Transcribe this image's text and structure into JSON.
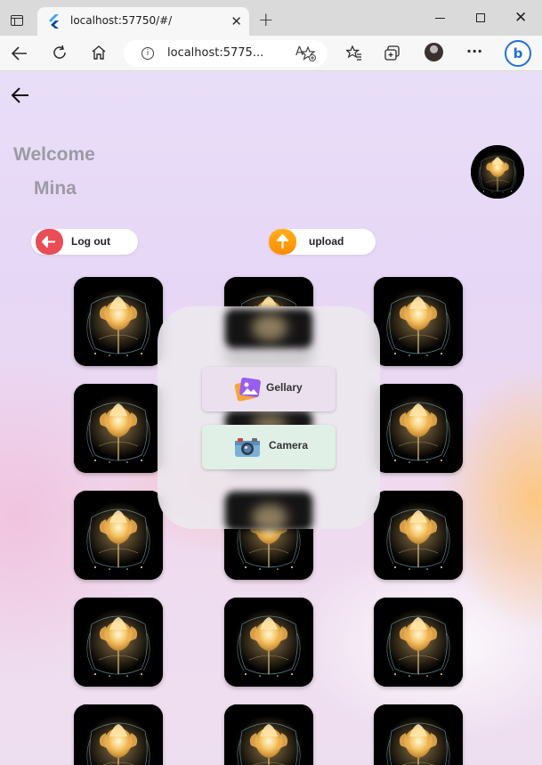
{
  "browser": {
    "tab_title": "localhost:57750/#/",
    "address": "localhost:5775...",
    "tab_close_glyph": "✕",
    "new_tab_glyph": "+",
    "window_close_glyph": "✕",
    "more_glyph": "···",
    "bing_letter": "b"
  },
  "app": {
    "welcome": "Welcome",
    "username": "Mina",
    "logout_label": "Log out",
    "upload_label": "upload",
    "dialog": {
      "gallery_label": "Gellary",
      "camera_label": "Camera"
    },
    "colors": {
      "logout_icon_bg": "#ea4d55",
      "upload_icon_bg": "#ff9a00",
      "gallery_button_bg": "#ebe1ee",
      "camera_button_bg": "#e0f0e6",
      "heading_text": "#9c9aa2"
    },
    "icons": {
      "back": "arrow-left-icon",
      "logout": "arrow-left-icon",
      "upload": "arrow-up-icon",
      "gallery": "image-gallery-icon",
      "camera": "camera-icon"
    },
    "photo_grid": {
      "columns": 3,
      "rows_visible": 5,
      "image": "glowing-golden-flower-on-black"
    }
  }
}
